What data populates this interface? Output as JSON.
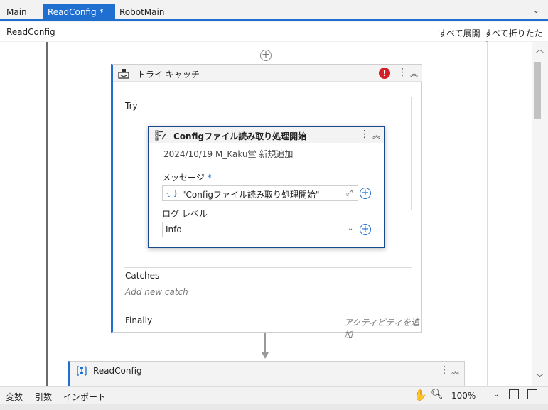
{
  "tabs": [
    {
      "label": "Main"
    },
    {
      "label": "ReadConfig *"
    },
    {
      "label": "RobotMain"
    }
  ],
  "breadcrumb": "ReadConfig",
  "toolbar": {
    "expand_all": "すべて展開",
    "collapse_all": "すべて折りたたむ"
  },
  "trycatch": {
    "title": "トライ キャッチ",
    "error_badge": "!",
    "try_label": "Try",
    "catches_label": "Catches",
    "add_catch": "Add new catch",
    "finally_label": "Finally",
    "add_activity": "アクティビティを追加"
  },
  "log_activity": {
    "title": "Configファイル読み取り処理開始",
    "annotation": "2024/10/19 M_Kaku堂 新規追加",
    "message_label": "メッセージ",
    "required_mark": "*",
    "message_value": "\"Configファイル読み取り処理開始\"",
    "level_label": "ログ レベル",
    "level_value": "Info"
  },
  "workflow_card": {
    "title": "ReadConfig"
  },
  "statusbar": {
    "variables": "変数",
    "arguments": "引数",
    "imports": "インポート",
    "zoom": "100%"
  },
  "colors": {
    "accent": "#1f6fd1",
    "error": "#d21f26",
    "selected_border": "#1a4a8e"
  },
  "icons": [
    "close-icon",
    "chevron-down-icon",
    "add-circle-icon",
    "trycatch-icon",
    "error-icon",
    "more-vert-icon",
    "collapse-icon",
    "log-message-icon",
    "expression-icon",
    "expand-icon",
    "plus-circle-icon",
    "workflow-icon",
    "hand-icon",
    "zoom-icon",
    "fit-screen-icon",
    "overview-icon"
  ]
}
